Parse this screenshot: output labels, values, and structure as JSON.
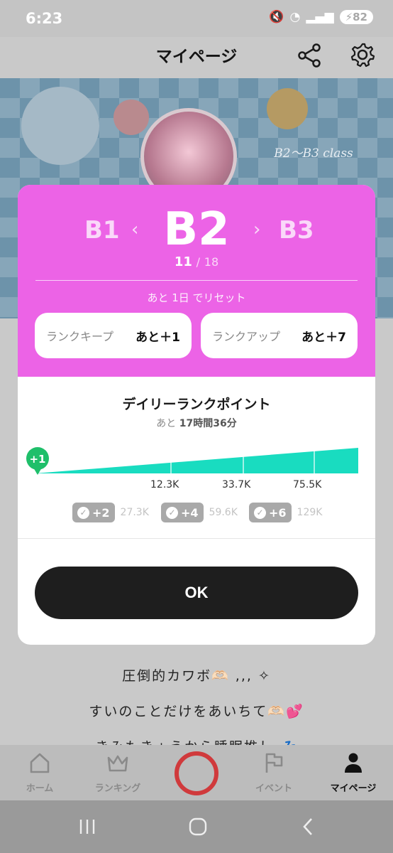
{
  "status_bar": {
    "time": "6:23",
    "battery": "82"
  },
  "header": {
    "title": "マイページ"
  },
  "banner": {
    "star_text": "B2～B3 class"
  },
  "rank_modal": {
    "prev_rank": "B1",
    "current_rank": "B2",
    "next_rank": "B3",
    "progress_current": "11",
    "progress_separator": "/",
    "progress_total": "18",
    "reset_text": "あと 1日 でリセット",
    "keep": {
      "label": "ランクキープ",
      "value": "あと＋1"
    },
    "up": {
      "label": "ランクアップ",
      "value": "あと＋7"
    },
    "daily_title": "デイリーランクポイント",
    "daily_remaining_prefix": "あと",
    "daily_remaining": "17時間36分",
    "current_badge": "+1",
    "ticks": [
      "12.3K",
      "33.7K",
      "75.5K"
    ],
    "bonuses": [
      {
        "label": "+2",
        "points": "27.3K"
      },
      {
        "label": "+4",
        "points": "59.6K"
      },
      {
        "label": "+6",
        "points": "129K"
      }
    ],
    "ok_label": "OK",
    "accent_color": "#ec63e6",
    "bar_color": "#19dcc0"
  },
  "background_lines": [
    "圧倒的カワボ🫶🏻 ,,, ✧",
    "すいのことだけをあいちて🫶🏻💕",
    "きみもきょうから睡眠推し 💤"
  ],
  "bottom_nav": {
    "items": [
      {
        "label": "ホーム",
        "icon": "home-icon"
      },
      {
        "label": "ランキング",
        "icon": "crown-icon"
      },
      {
        "label": "",
        "icon": "live-circle-icon"
      },
      {
        "label": "イベント",
        "icon": "flag-icon"
      },
      {
        "label": "マイページ",
        "icon": "person-icon"
      }
    ]
  }
}
